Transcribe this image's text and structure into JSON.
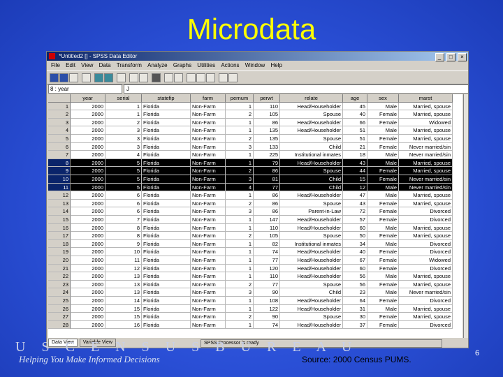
{
  "slide": {
    "title": "Microdata",
    "org_wordmark": "U S C E N S U S B U R E A U",
    "tagline": "Helping You Make Informed Decisions",
    "source": "Source: 2000 Census PUMS.",
    "page_number": "6"
  },
  "window": {
    "title": "*Untitled2 [] - SPSS Data Editor",
    "buttons": [
      "_",
      "□",
      "×"
    ]
  },
  "menu": [
    "File",
    "Edit",
    "View",
    "Data",
    "Transform",
    "Analyze",
    "Graphs",
    "Utilities",
    "Actions",
    "Window",
    "Help"
  ],
  "cell_editor": {
    "ref": "8 : year",
    "value": "J"
  },
  "columns": [
    "year",
    "serial",
    "statefip",
    "farm",
    "pernum",
    "perwt",
    "relate",
    "age",
    "sex",
    "marst"
  ],
  "rows": [
    [
      "1",
      "2000",
      "1",
      "Florida",
      "Non-Farm",
      "1",
      "110",
      "Head/Householder",
      "45",
      "Male",
      "Married, spouse"
    ],
    [
      "2",
      "2000",
      "1",
      "Florida",
      "Non-Farm",
      "2",
      "105",
      "Spouse",
      "40",
      "Female",
      "Married, spouse"
    ],
    [
      "3",
      "2000",
      "2",
      "Florida",
      "Non-Farm",
      "1",
      "86",
      "Head/Householder",
      "66",
      "Female",
      "Widowed"
    ],
    [
      "4",
      "2000",
      "3",
      "Florida",
      "Non-Farm",
      "1",
      "135",
      "Head/Householder",
      "51",
      "Male",
      "Married, spouse"
    ],
    [
      "5",
      "2000",
      "3",
      "Florida",
      "Non-Farm",
      "2",
      "135",
      "Spouse",
      "51",
      "Female",
      "Married, spouse"
    ],
    [
      "6",
      "2000",
      "3",
      "Florida",
      "Non-Farm",
      "3",
      "133",
      "Child",
      "21",
      "Female",
      "Never married/sin"
    ],
    [
      "7",
      "2000",
      "4",
      "Florida",
      "Non-Farm",
      "1",
      "225",
      "Institutional inmates",
      "18",
      "Male",
      "Never married/sin"
    ],
    [
      "8",
      "2000",
      "5",
      "Florida",
      "Non-Farm",
      "1",
      "79",
      "Head/Householder",
      "43",
      "Male",
      "Married, spouse"
    ],
    [
      "9",
      "2000",
      "5",
      "Florida",
      "Non-Farm",
      "2",
      "86",
      "Spouse",
      "44",
      "Female",
      "Married, spouse"
    ],
    [
      "10",
      "2000",
      "5",
      "Florida",
      "Non-Farm",
      "3",
      "81",
      "Child",
      "15",
      "Female",
      "Never married/sin"
    ],
    [
      "11",
      "2000",
      "5",
      "Florida",
      "Non-Farm",
      "4",
      "77",
      "Child",
      "12",
      "Male",
      "Never married/sin"
    ],
    [
      "12",
      "2000",
      "6",
      "Florida",
      "Non-Farm",
      "1",
      "86",
      "Head/Householder",
      "47",
      "Male",
      "Married, spouse"
    ],
    [
      "13",
      "2000",
      "6",
      "Florida",
      "Non-Farm",
      "2",
      "86",
      "Spouse",
      "43",
      "Female",
      "Married, spouse"
    ],
    [
      "14",
      "2000",
      "6",
      "Florida",
      "Non-Farm",
      "3",
      "86",
      "Parent-in-Law",
      "72",
      "Female",
      "Divorced"
    ],
    [
      "15",
      "2000",
      "7",
      "Florida",
      "Non-Farm",
      "1",
      "147",
      "Head/Householder",
      "57",
      "Female",
      "Divorced"
    ],
    [
      "16",
      "2000",
      "8",
      "Florida",
      "Non-Farm",
      "1",
      "110",
      "Head/Householder",
      "60",
      "Male",
      "Married, spouse"
    ],
    [
      "17",
      "2000",
      "8",
      "Florida",
      "Non-Farm",
      "2",
      "105",
      "Spouse",
      "50",
      "Female",
      "Married, spouse"
    ],
    [
      "18",
      "2000",
      "9",
      "Florida",
      "Non-Farm",
      "1",
      "82",
      "Institutional inmates",
      "34",
      "Male",
      "Divorced"
    ],
    [
      "19",
      "2000",
      "10",
      "Florida",
      "Non-Farm",
      "1",
      "74",
      "Head/Householder",
      "40",
      "Female",
      "Divorced"
    ],
    [
      "20",
      "2000",
      "11",
      "Florida",
      "Non-Farm",
      "1",
      "77",
      "Head/Householder",
      "67",
      "Female",
      "Widowed"
    ],
    [
      "21",
      "2000",
      "12",
      "Florida",
      "Non-Farm",
      "1",
      "120",
      "Head/Householder",
      "60",
      "Female",
      "Divorced"
    ],
    [
      "22",
      "2000",
      "13",
      "Florida",
      "Non-Farm",
      "1",
      "110",
      "Head/Householder",
      "56",
      "Male",
      "Married, spouse"
    ],
    [
      "23",
      "2000",
      "13",
      "Florida",
      "Non-Farm",
      "2",
      "77",
      "Spouse",
      "56",
      "Female",
      "Married, spouse"
    ],
    [
      "24",
      "2000",
      "13",
      "Florida",
      "Non-Farm",
      "3",
      "90",
      "Child",
      "23",
      "Male",
      "Never married/sin"
    ],
    [
      "25",
      "2000",
      "14",
      "Florida",
      "Non-Farm",
      "1",
      "108",
      "Head/Householder",
      "64",
      "Female",
      "Divorced"
    ],
    [
      "26",
      "2000",
      "15",
      "Florida",
      "Non-Farm",
      "1",
      "122",
      "Head/Householder",
      "31",
      "Male",
      "Married, spouse"
    ],
    [
      "27",
      "2000",
      "15",
      "Florida",
      "Non-Farm",
      "2",
      "90",
      "Spouse",
      "30",
      "Female",
      "Married, spouse"
    ],
    [
      "28",
      "2000",
      "16",
      "Florida",
      "Non-Farm",
      "1",
      "74",
      "Head/Householder",
      "37",
      "Female",
      "Divorced"
    ]
  ],
  "selected_rows": [
    8,
    9,
    10,
    11
  ],
  "tabs": [
    "Data View",
    "Variable View"
  ],
  "status": "SPSS Processor is ready",
  "colors": {
    "background": "#2a4fd6",
    "title": "#ffff00",
    "selection": "#000000"
  }
}
